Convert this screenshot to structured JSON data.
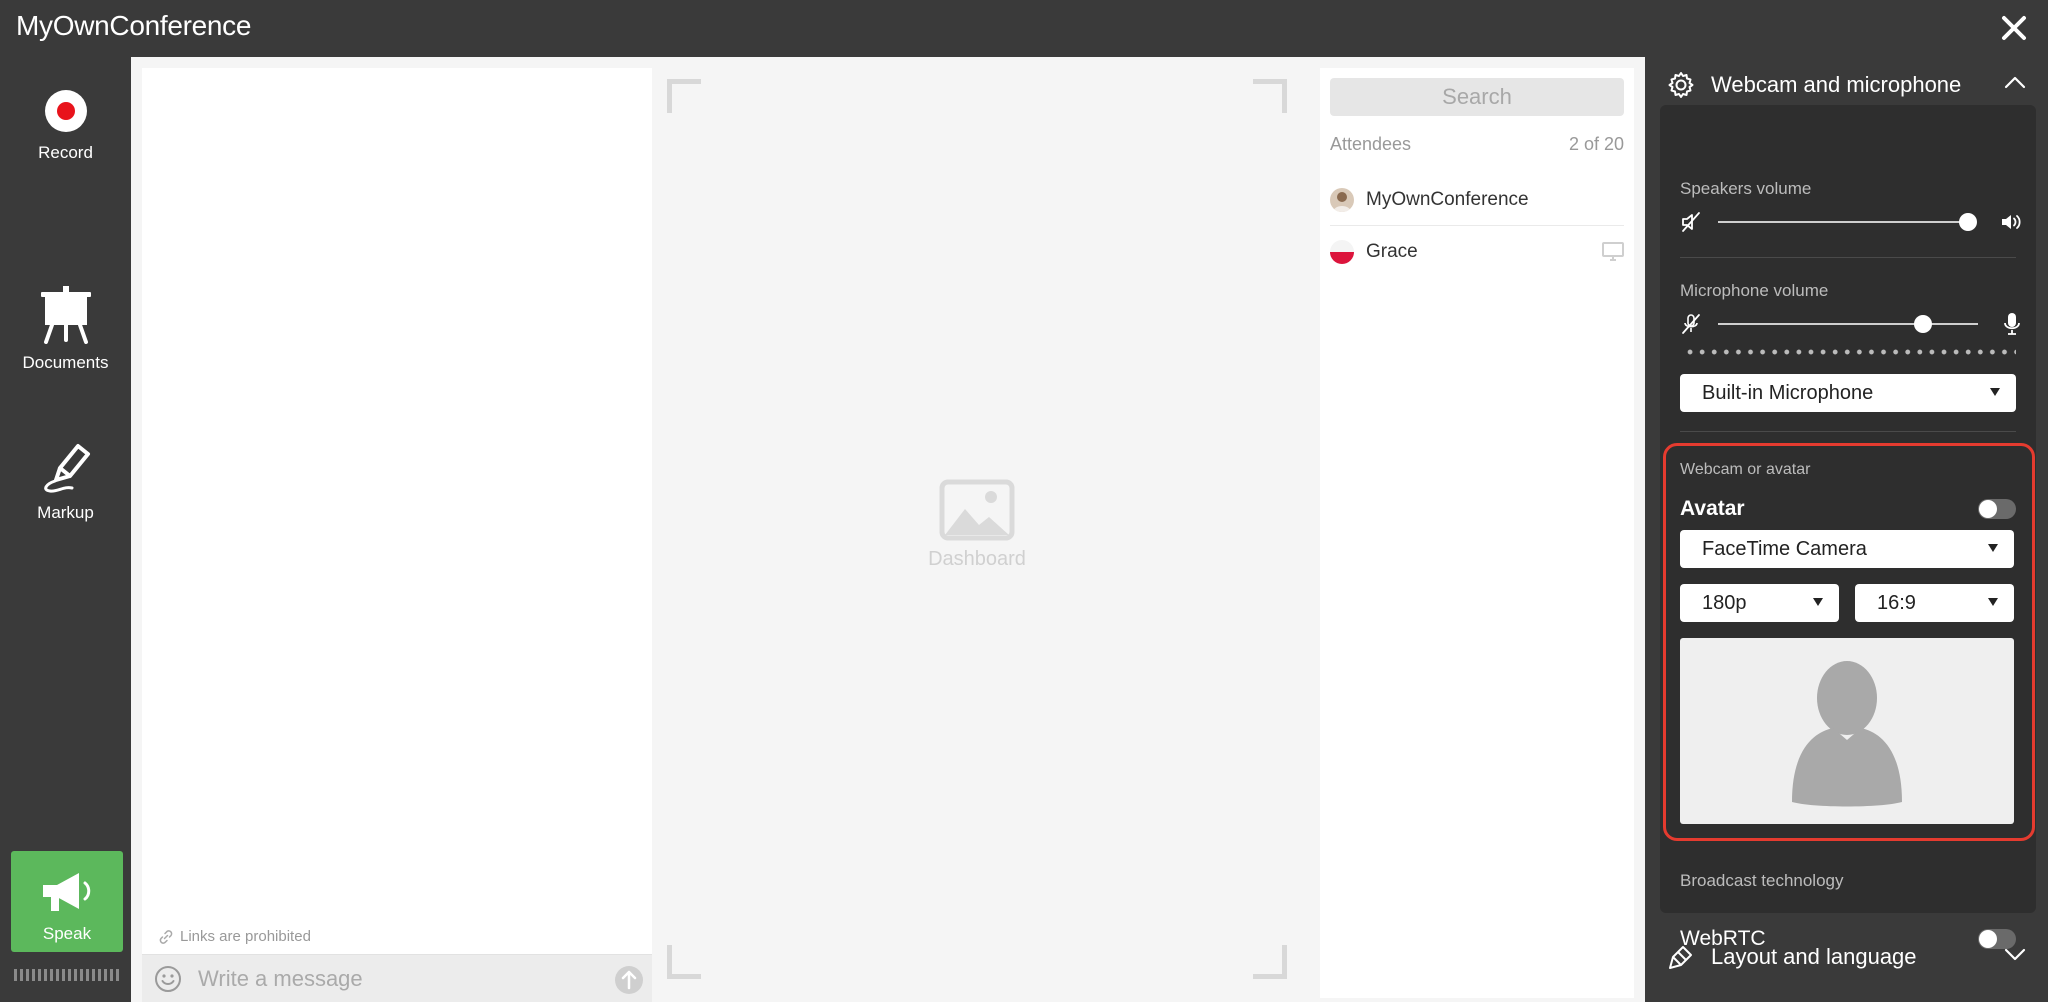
{
  "window": {
    "title": "MyOwnConference",
    "close_icon": "close-icon"
  },
  "toolbar": {
    "record_label": "Record",
    "documents_label": "Documents",
    "markup_label": "Markup",
    "speak_label": "Speak",
    "speak_color": "#5cb85c",
    "record_color": "#e8131b"
  },
  "chat": {
    "links_note": "Links are prohibited",
    "message_placeholder": "Write a message"
  },
  "dashboard": {
    "label": "Dashboard"
  },
  "attendees": {
    "search_placeholder": "Search",
    "header": "Attendees",
    "count": "2 of 20",
    "items": [
      {
        "name": "MyOwnConference",
        "avatar": "photo-avatar"
      },
      {
        "name": "Grace",
        "avatar": "flag-avatar",
        "status_icon": "screen-icon"
      }
    ]
  },
  "settings": {
    "webcam_section": {
      "title": "Webcam and microphone",
      "expanded": true,
      "speakers_label": "Speakers volume",
      "speakers_level": 1.0,
      "microphone_label": "Microphone volume",
      "microphone_level": 0.79,
      "microphone_device": "Built-in Microphone",
      "webcam_group_label": "Webcam or avatar",
      "avatar_label": "Avatar",
      "avatar_enabled": false,
      "camera_device": "FaceTime Camera",
      "resolution": "180p",
      "aspect_ratio": "16:9",
      "broadcast_label": "Broadcast technology",
      "webrtc_label": "WebRTC",
      "webrtc_enabled": false,
      "highlight_color": "#e53b2f"
    },
    "layout_section": {
      "title": "Layout and language",
      "expanded": false
    }
  }
}
